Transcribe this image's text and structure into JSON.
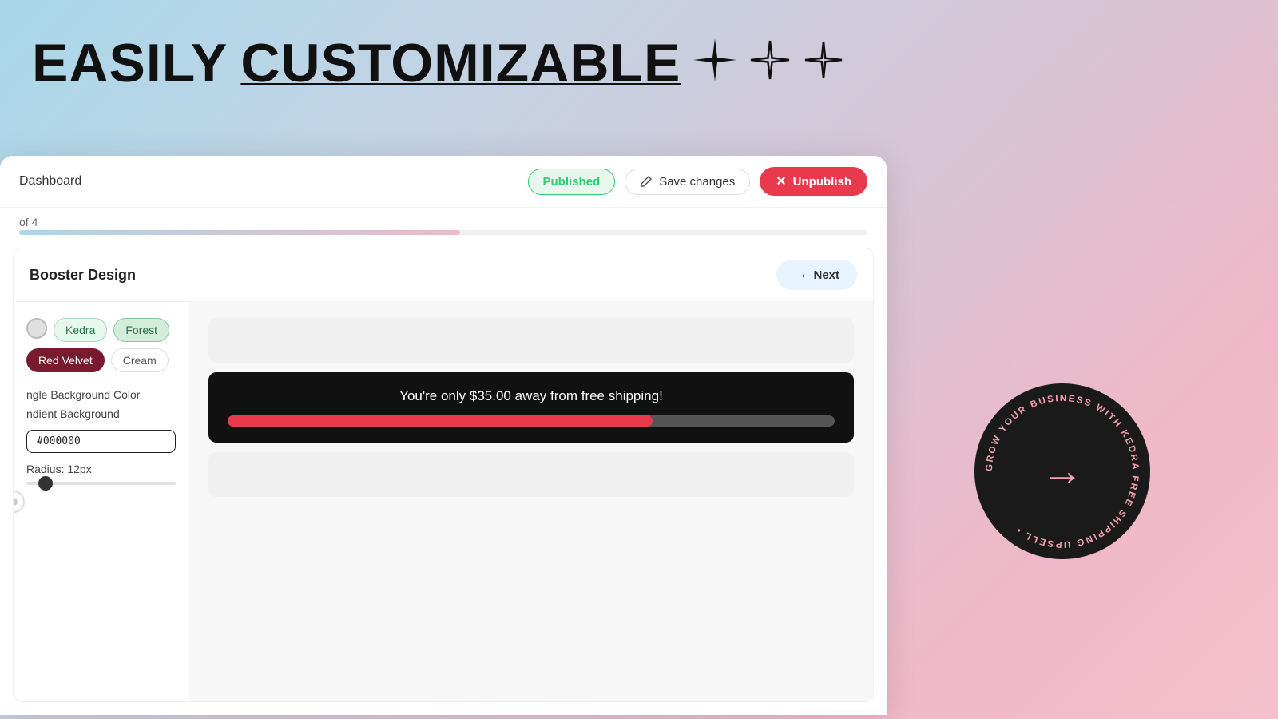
{
  "header": {
    "title_part1": "EASILY",
    "title_part2": "CUSTOMIZABLE"
  },
  "topbar": {
    "breadcrumb": "Dashboard",
    "published_label": "Published",
    "save_changes_label": "Save changes",
    "unpublish_label": "Unpublish"
  },
  "progress": {
    "step_label": "of 4",
    "fill_percent": 52
  },
  "section": {
    "title": "Booster Design",
    "next_label": "Next"
  },
  "themes": {
    "chips": [
      {
        "label": "Kedra",
        "style": "kedra"
      },
      {
        "label": "Forest",
        "style": "forest"
      },
      {
        "label": "Red Velvet",
        "style": "redvelvet"
      },
      {
        "label": "Cream",
        "style": "cream"
      }
    ]
  },
  "design_options": {
    "bg_color_label": "ngle Background Color",
    "gradient_label": "ndient Background",
    "hex_value": "#000000",
    "radius_label": "Radius: 12px"
  },
  "preview_banner": {
    "text": "You're only $35.00 away from free shipping!",
    "progress_percent": 70
  },
  "circular_badge": {
    "ring_text": "GROW YOUR BUSINESS WITH KEDRA FREE SHIPPING UPSELL"
  }
}
